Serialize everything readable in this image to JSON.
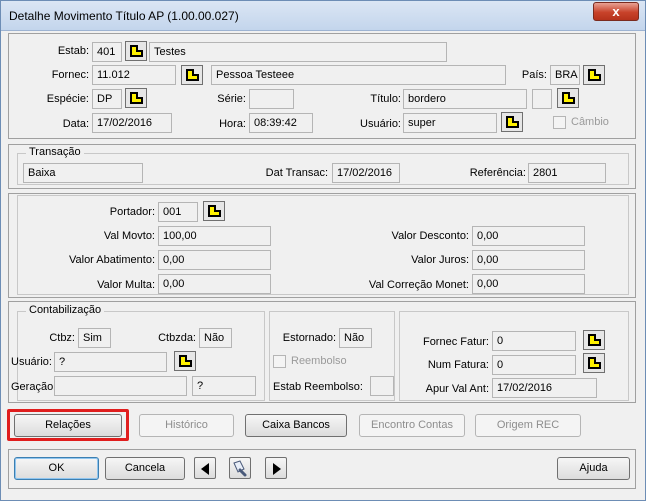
{
  "window": {
    "title": "Detalhe Movimento Título AP (1.00.00.027)",
    "close_glyph": "x"
  },
  "header": {
    "estab_label": "Estab:",
    "estab_code": "401",
    "estab_name": "Testes",
    "fornec_label": "Fornec:",
    "fornec_code": "11.012",
    "fornec_name": "Pessoa Testeee",
    "pais_label": "País:",
    "pais_value": "BRA",
    "especie_label": "Espécie:",
    "especie_value": "DP",
    "serie_label": "Série:",
    "serie_value": "",
    "titulo_label": "Título:",
    "titulo_value": "bordero",
    "titulo_extra": "",
    "data_label": "Data:",
    "data_value": "17/02/2016",
    "hora_label": "Hora:",
    "hora_value": "08:39:42",
    "usuario_label": "Usuário:",
    "usuario_value": "super",
    "cambio_label": "Câmbio"
  },
  "transacao": {
    "legend": "Transação",
    "value": "Baixa",
    "dat_label": "Dat Transac:",
    "dat_value": "17/02/2016",
    "ref_label": "Referência:",
    "ref_value": "2801"
  },
  "valores": {
    "portador_label": "Portador:",
    "portador_value": "001",
    "val_movto_label": "Val Movto:",
    "val_movto_value": "100,00",
    "val_abat_label": "Valor Abatimento:",
    "val_abat_value": "0,00",
    "val_multa_label": "Valor Multa:",
    "val_multa_value": "0,00",
    "val_desc_label": "Valor Desconto:",
    "val_desc_value": "0,00",
    "val_juros_label": "Valor Juros:",
    "val_juros_value": "0,00",
    "val_corr_label": "Val Correção Monet:",
    "val_corr_value": "0,00"
  },
  "contab": {
    "legend": "Contabilização",
    "ctbz_label": "Ctbz:",
    "ctbz_value": "Sim",
    "ctbzda_label": "Ctbzda:",
    "ctbzda_value": "Não",
    "usuario_label": "Usuário:",
    "usuario_value": "?",
    "geracao_label": "Geração:",
    "geracao_value": "",
    "geracao_extra": "?",
    "estornado_label": "Estornado:",
    "estornado_value": "Não",
    "reembolso_label": "Reembolso",
    "estab_reemb_label": "Estab Reembolso:",
    "estab_reemb_value": "",
    "fornec_fatur_label": "Fornec Fatur:",
    "fornec_fatur_value": "0",
    "num_fatura_label": "Num Fatura:",
    "num_fatura_value": "0",
    "apur_label": "Apur Val Ant:",
    "apur_value": "17/02/2016"
  },
  "actions": {
    "relacoes": "Relações",
    "historico": "Histórico",
    "caixa_bancos": "Caixa Bancos",
    "encontro_contas": "Encontro Contas",
    "origem_rec": "Origem REC"
  },
  "footer": {
    "ok": "OK",
    "cancela": "Cancela",
    "ajuda": "Ajuda"
  }
}
